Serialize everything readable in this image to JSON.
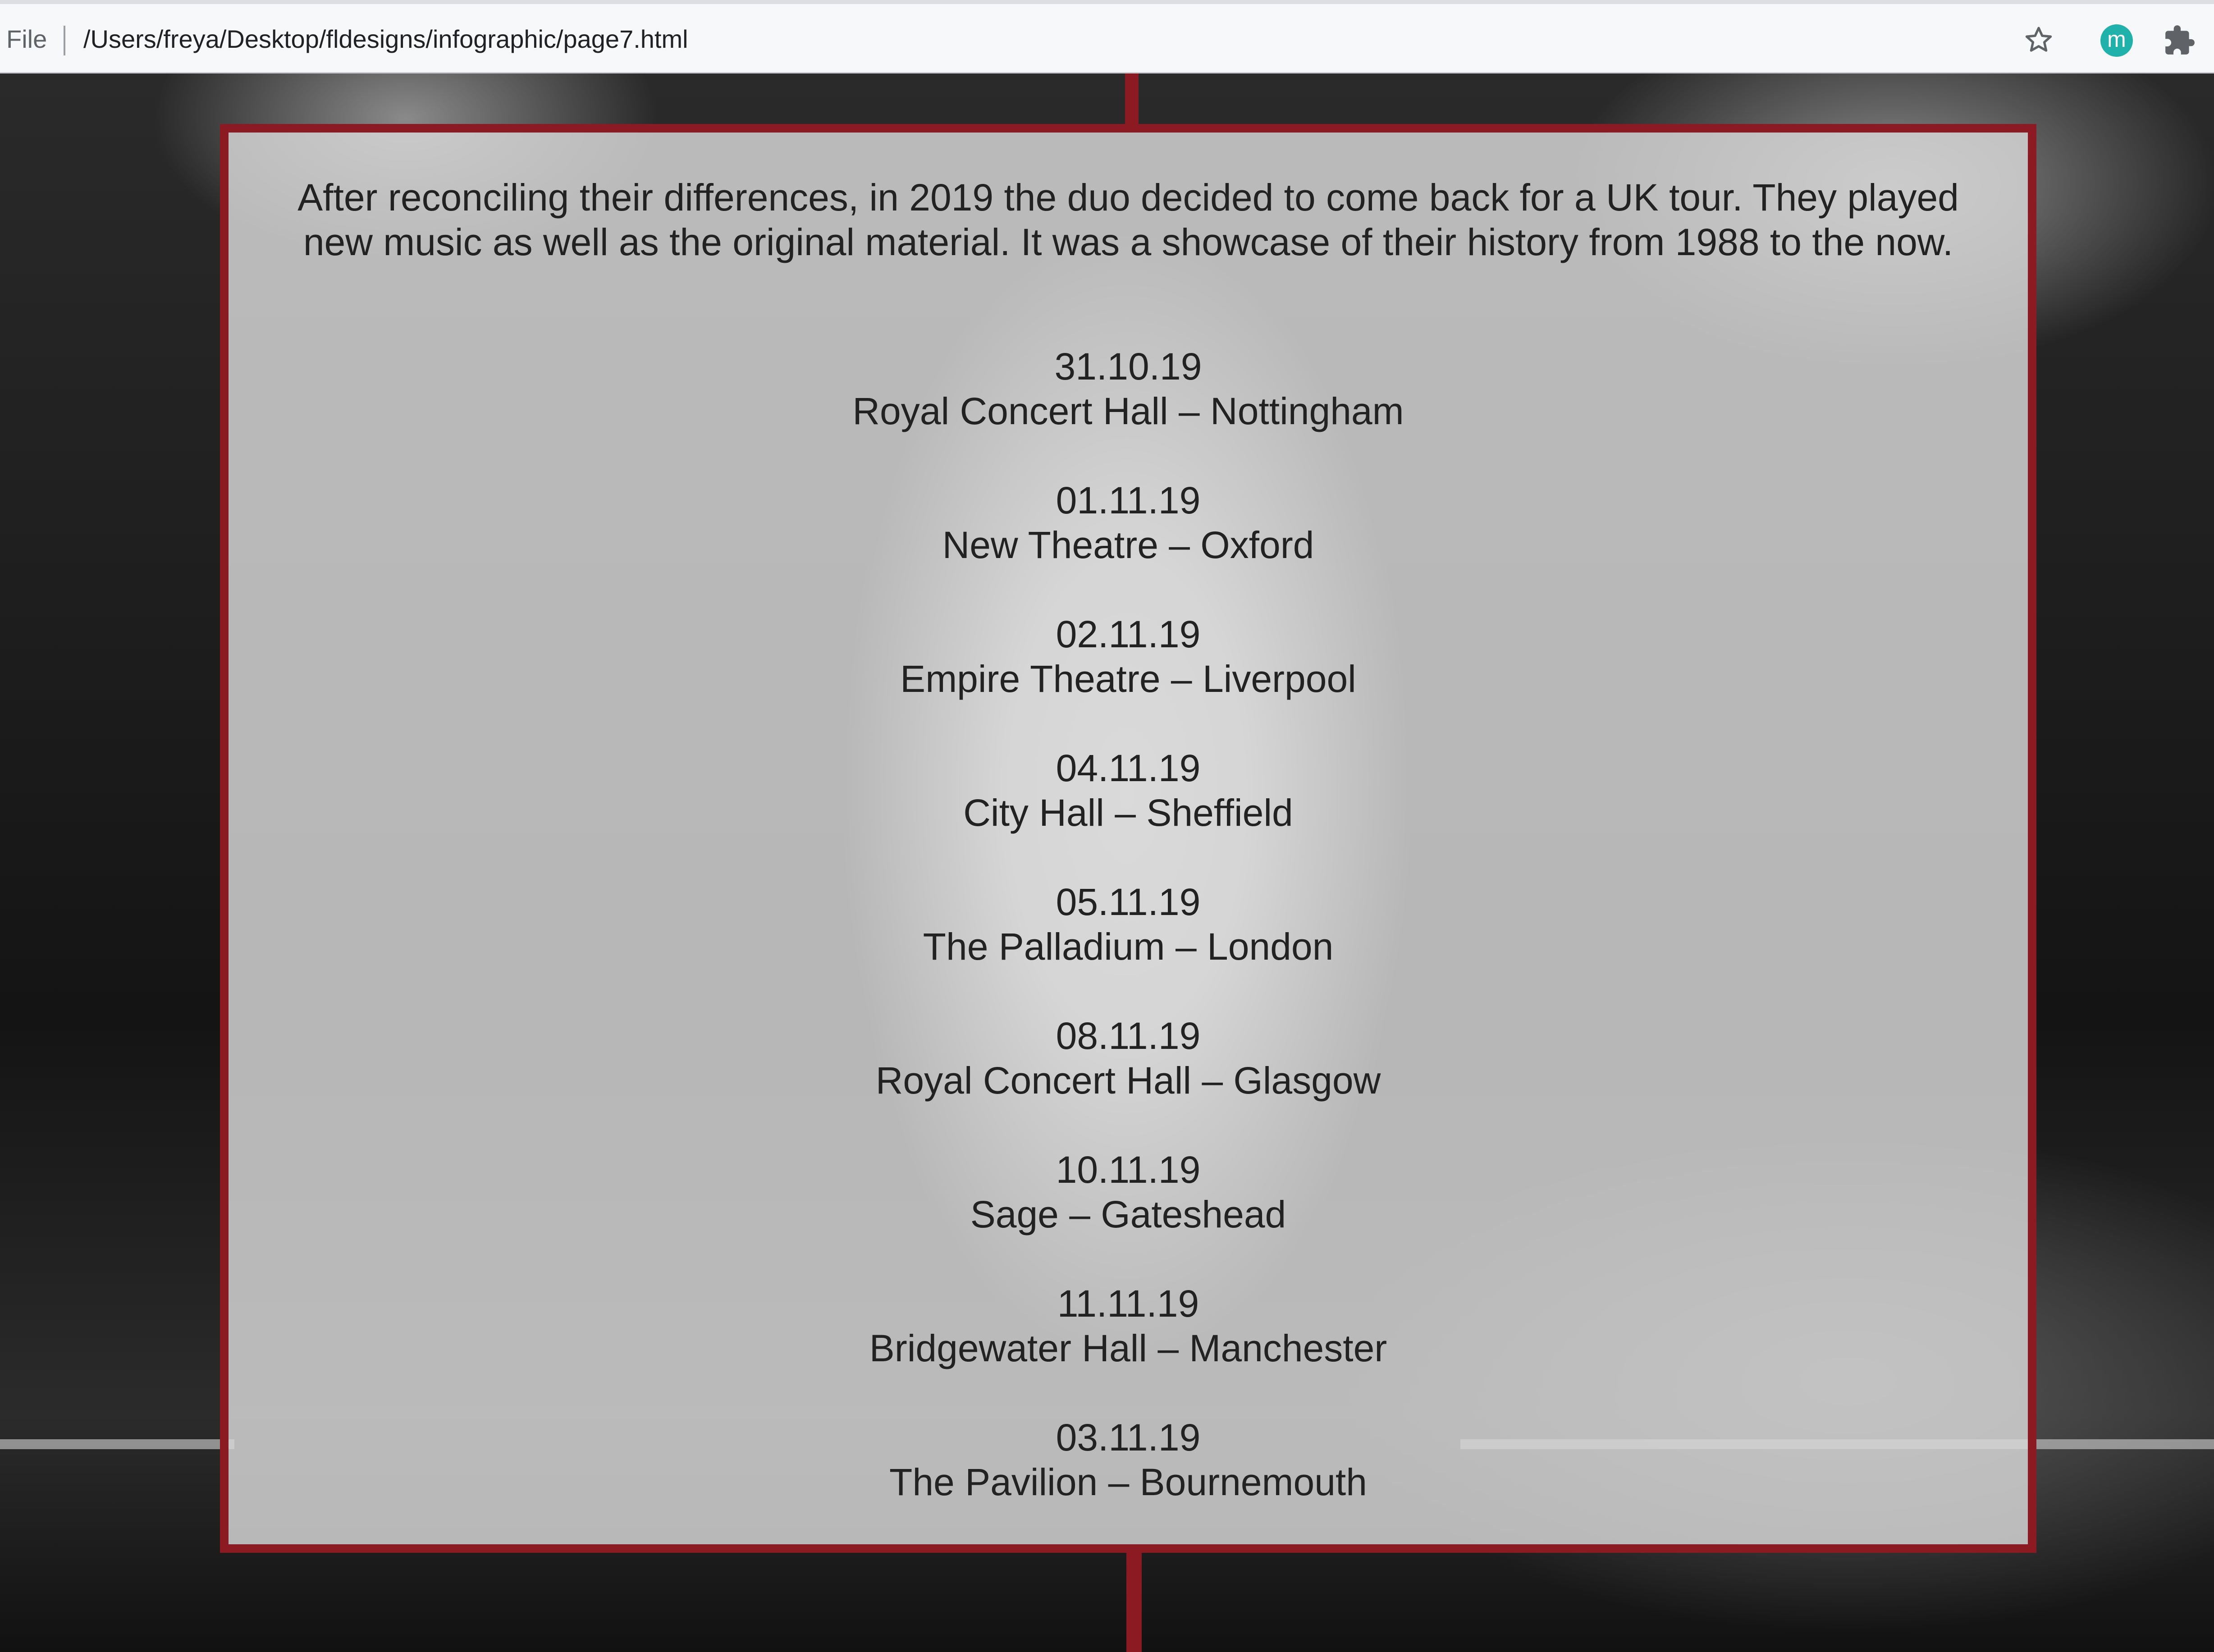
{
  "browser": {
    "file_label": "File",
    "url": "/Users/freya/Desktop/fldesigns/infographic/page7.html",
    "bookmark_icon": "star-icon",
    "profile_initial": "m",
    "extensions_icon": "puzzle-icon",
    "accent_color": "#20b2aa"
  },
  "page": {
    "border_color": "#8b1a22",
    "intro": "After reconciling their differences, in 2019 the duo decided to come back for a UK tour. They played new music as well as the original material. It was a showcase of their history from 1988 to the now.",
    "tour_dates": [
      {
        "date": "31.10.19",
        "venue": "Royal Concert Hall – Nottingham"
      },
      {
        "date": "01.11.19",
        "venue": "New Theatre – Oxford"
      },
      {
        "date": "02.11.19",
        "venue": "Empire Theatre – Liverpool"
      },
      {
        "date": "04.11.19",
        "venue": "City Hall – Sheffield"
      },
      {
        "date": "05.11.19",
        "venue": "The Palladium – London"
      },
      {
        "date": "08.11.19",
        "venue": "Royal Concert Hall – Glasgow"
      },
      {
        "date": "10.11.19",
        "venue": "Sage – Gateshead"
      },
      {
        "date": "11.11.19",
        "venue": "Bridgewater Hall – Manchester"
      },
      {
        "date": "03.11.19",
        "venue": "The Pavilion – Bournemouth"
      }
    ]
  }
}
